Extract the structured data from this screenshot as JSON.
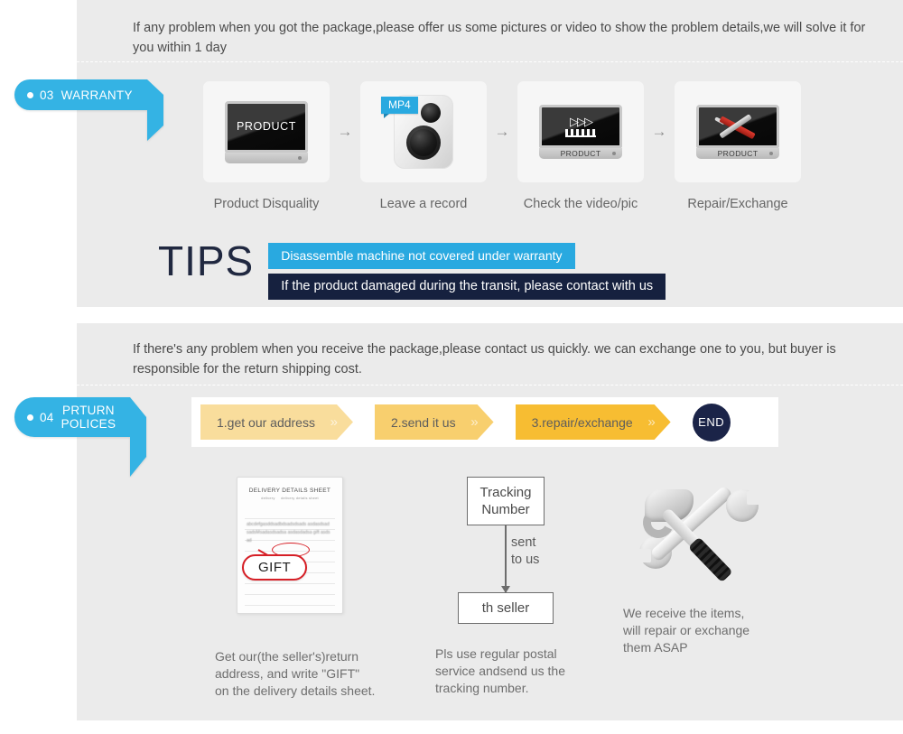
{
  "colors": {
    "panel_bg": "#ebebeb",
    "tag_blue": "#34b3e4",
    "tip_blue": "#29a9e0",
    "tip_navy": "#16213f",
    "flow_1": "#f9dd9c",
    "flow_2": "#f8cf6e",
    "flow_3": "#f7bd32",
    "end_navy": "#1b2448",
    "accent_red": "#d61f26"
  },
  "warranty": {
    "tag": {
      "number": "03",
      "label": "WARRANTY"
    },
    "intro": "If any problem when you got the package,please offer us some pictures or video to show the problem details,we will solve it for you within 1 day",
    "steps": [
      {
        "label": "Product Disquality",
        "device": "monitor",
        "screen_text": "PRODUCT",
        "base_text": ""
      },
      {
        "label": "Leave a record",
        "device": "camera",
        "badge": "MP4"
      },
      {
        "label": "Check the video/pic",
        "device": "monitor-clapper",
        "base_text": "PRODUCT"
      },
      {
        "label": "Repair/Exchange",
        "device": "monitor-tools",
        "base_text": "PRODUCT"
      }
    ],
    "arrow": "→",
    "tips": {
      "heading": "TIPS",
      "bars": [
        "Disassemble machine not covered under warranty",
        "If the product damaged during the transit, please contact with us"
      ]
    }
  },
  "returns": {
    "tag": {
      "number": "04",
      "label_line1": "PRTURN",
      "label_line2": "POLICES"
    },
    "intro": "If  there's any problem when you receive the package,please contact us quickly. we can exchange one to you, but buyer is responsible for the return shipping cost.",
    "flow": {
      "steps": [
        "1.get our address",
        "2.send it us",
        "3.repair/exchange"
      ],
      "chevrons": "»",
      "end_label": "END"
    },
    "figures": [
      {
        "type": "delivery-sheet",
        "sheet_title": "DELIVERY DETAILS SHEET",
        "sheet_sub_left": "delivery",
        "sheet_sub_right": "delivery details sheet",
        "sheet_body": "abcdefgasddsadbdsadsdsads asdasdsadsadsMsadasdsadsa asdasdadsa gift asdsad",
        "callout": "GIFT",
        "caption": "Get our(the seller's)return\naddress, and write \"GIFT\"\non the delivery details sheet."
      },
      {
        "type": "tracking-flow",
        "box_top": "Tracking\nNumber",
        "arrow_label": "sent\nto us",
        "box_bottom": "th seller",
        "caption": "Pls use regular postal\nservice andsend us the\n tracking number."
      },
      {
        "type": "tools",
        "caption": "We receive the items,\nwill repair or exchange\n them ASAP"
      }
    ]
  }
}
